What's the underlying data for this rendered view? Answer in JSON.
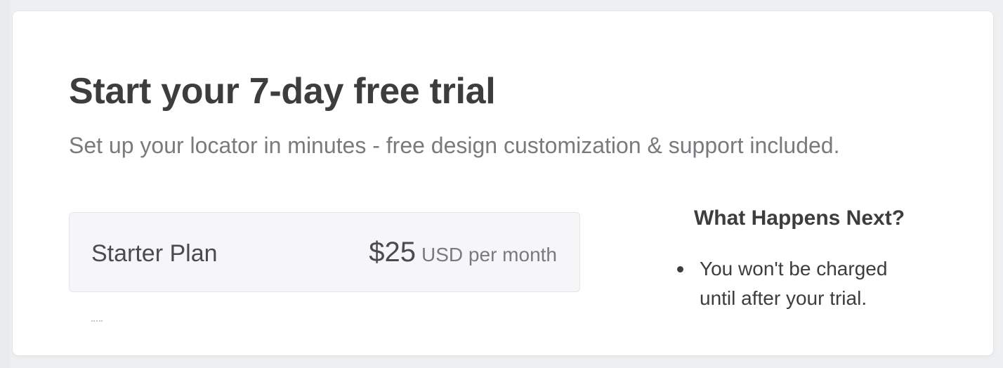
{
  "trial": {
    "title": "Start your 7-day free trial",
    "subtitle": "Set up your locator in minutes - free design customization & support included."
  },
  "plan": {
    "name": "Starter Plan",
    "price": "$25",
    "period": "USD per month"
  },
  "next_steps": {
    "heading": "What Happens Next?",
    "items": [
      "You won't be charged until after your trial."
    ]
  }
}
